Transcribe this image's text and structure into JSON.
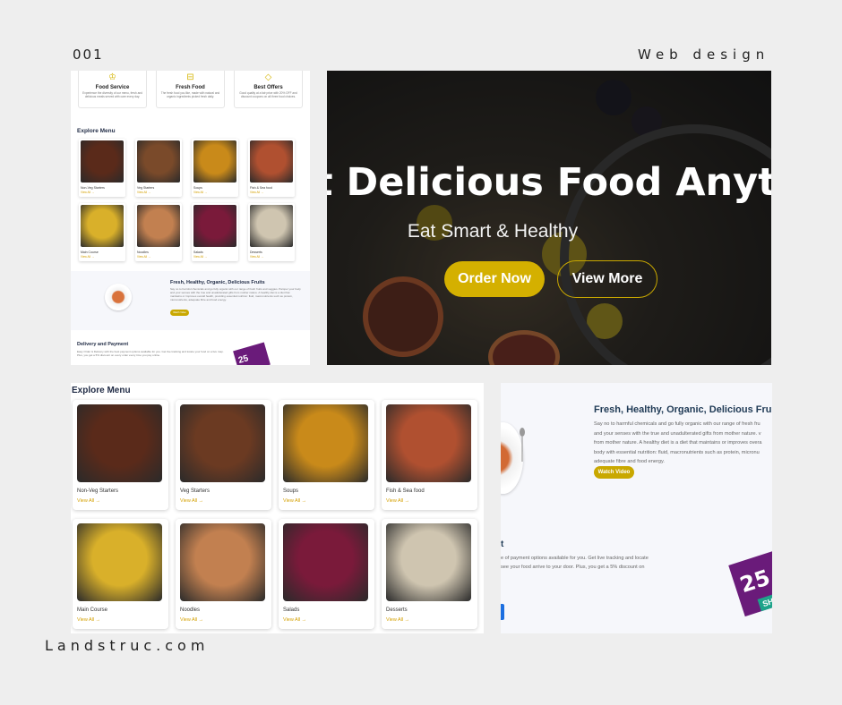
{
  "header": {
    "number": "001",
    "category": "Web design"
  },
  "footer": {
    "site": "Landstruc.com"
  },
  "panel_a": {
    "services": [
      {
        "icon": "chef-hat-icon",
        "title": "Food Service",
        "text": "Experience the diversity of our menu, fresh and delicious meals served with care every day."
      },
      {
        "icon": "basket-icon",
        "title": "Fresh Food",
        "text": "The fresh food you like, made with natural and organic ingredients picked fresh daily."
      },
      {
        "icon": "tag-icon",
        "title": "Best Offers",
        "text": "Good quality at a fair price with 20% OFF and discount coupons on all three food choices."
      }
    ],
    "menu_title": "Explore Menu",
    "menu_items": [
      {
        "name": "Non-Veg Starters",
        "view": "View All →",
        "color": "#5a2a1a"
      },
      {
        "name": "Veg Starters",
        "view": "View All →",
        "color": "#7a4a2a"
      },
      {
        "name": "Soups",
        "view": "View All →",
        "color": "#c98a1a"
      },
      {
        "name": "Fish & Sea food",
        "view": "View All →",
        "color": "#b05030"
      },
      {
        "name": "Main Course",
        "view": "View All →",
        "color": "#d9b02a"
      },
      {
        "name": "Noodles",
        "view": "View All →",
        "color": "#c28050"
      },
      {
        "name": "Salads",
        "view": "View All →",
        "color": "#7a1a3a"
      },
      {
        "name": "Desserts",
        "view": "View All →",
        "color": "#cfc5b0"
      }
    ],
    "fruit": {
      "title": "Fresh, Healthy, Organic, Delicious Fruits",
      "text": "Say no to harmful chemicals and go fully organic with our range of fresh fruits and veggies. Pamper your body and your senses with the true and unadulterated gifts from mother nature. A healthy diet is a diet that maintains or improves overall health, providing essential nutrition: fluid, macronutrients such as protein, micronutrients, adequate fibre and food energy.",
      "button": "Watch Video"
    },
    "delivery": {
      "title": "Delivery and Payment",
      "text": "Easy Order & Delivery with the best payment options available for you. Get live tracking and locate your food on a live map. Plus, you get a 5% discount on every order every time you pay online."
    },
    "badge": "25"
  },
  "hero": {
    "title": "t Delicious Food Anyti",
    "subtitle": "Eat Smart & Healthy",
    "order_button": "Order Now",
    "more_button": "View More"
  },
  "panel_c": {
    "menu_title": "Explore Menu",
    "menu_items": [
      {
        "name": "Non-Veg Starters",
        "view": "View All →",
        "color": "#5a2a1a"
      },
      {
        "name": "Veg Starters",
        "view": "View All →",
        "color": "#6b3a22"
      },
      {
        "name": "Soups",
        "view": "View All →",
        "color": "#c98a1a"
      },
      {
        "name": "Fish & Sea food",
        "view": "View All →",
        "color": "#b05030"
      },
      {
        "name": "Main Course",
        "view": "View All →",
        "color": "#d9b02a"
      },
      {
        "name": "Noodles",
        "view": "View All →",
        "color": "#c28050"
      },
      {
        "name": "Salads",
        "view": "View All →",
        "color": "#7a1a3a"
      },
      {
        "name": "Desserts",
        "view": "View All →",
        "color": "#cfc5b0"
      }
    ]
  },
  "panel_d": {
    "title": "Fresh, Healthy, Organic, Delicious Fru",
    "lines": [
      "Say no to harmful chemicals and go fully organic with our range of fresh fru",
      "and your senses with the true and unadulterated gifts from mother nature. v",
      "from mother nature. A healthy diet is a diet that maintains or improves overa",
      "body with essential nutrition: fluid, macronutrients such as protein, micronu",
      "adequate fibre and food energy."
    ],
    "button": "Watch Video",
    "delivery_title": "t",
    "delivery_lines": [
      "e of payment options available for you. Get live tracking and locate",
      "see your food arrive to your door. Plus, you get a 5% discount on"
    ],
    "badge": "25",
    "badge_tag": "SH"
  }
}
